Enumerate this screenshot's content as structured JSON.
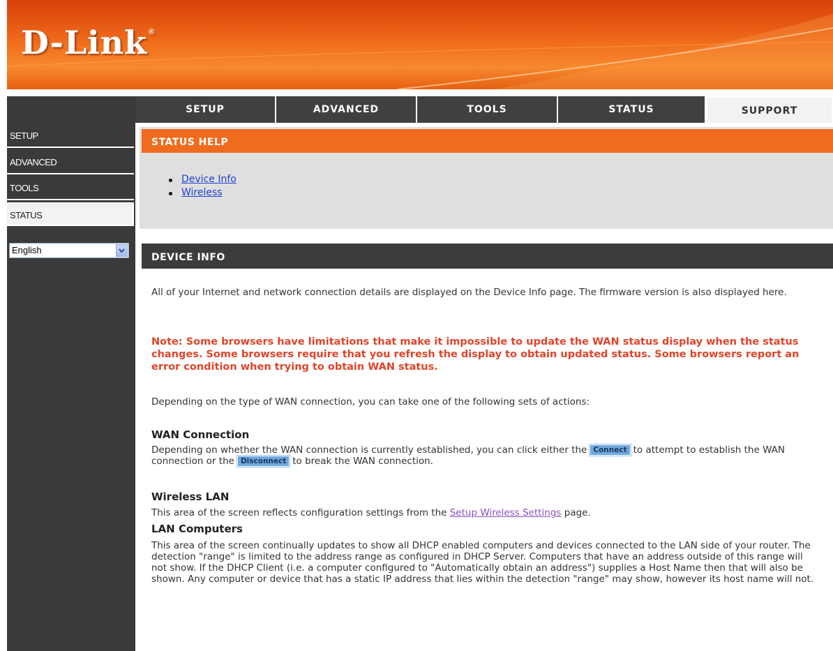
{
  "brand": {
    "logo_text": "D-Link",
    "logo_mark": "®"
  },
  "nav": {
    "tabs": [
      {
        "label": "SETUP",
        "active": false
      },
      {
        "label": "ADVANCED",
        "active": false
      },
      {
        "label": "TOOLS",
        "active": false
      },
      {
        "label": "STATUS",
        "active": false
      },
      {
        "label": "SUPPORT",
        "active": true
      }
    ]
  },
  "sidebar": {
    "items": [
      {
        "label": "SETUP",
        "active": false
      },
      {
        "label": "ADVANCED",
        "active": false
      },
      {
        "label": "TOOLS",
        "active": false
      },
      {
        "label": "STATUS",
        "active": true
      }
    ],
    "language": {
      "selected": "English"
    }
  },
  "status_help": {
    "title": "STATUS HELP",
    "links": [
      {
        "label": "Device Info"
      },
      {
        "label": "Wireless"
      }
    ]
  },
  "device_info": {
    "title": "DEVICE INFO",
    "intro": "All of your Internet and network connection details are displayed on the Device Info page. The firmware version is also displayed here.",
    "note": "Note: Some browsers have limitations that make it impossible to update the WAN status display when the status changes. Some browsers require that you refresh the display to obtain updated status. Some browsers report an error condition when trying to obtain WAN status.",
    "actions_intro": "Depending on the type of WAN connection, you can take one of the following sets of actions:",
    "wan": {
      "heading": "WAN Connection",
      "text_1": "Depending on whether the WAN connection is currently established, you can click either the",
      "connect_label": "Connect",
      "text_2": "to attempt to establish the WAN connection or the",
      "disconnect_label": "Disconnect",
      "text_3": "to break the WAN connection."
    },
    "wireless_lan": {
      "heading": "Wireless LAN",
      "text_before": "This area of the screen reflects configuration settings from the",
      "link_label": "Setup Wireless Settings",
      "text_after": "page."
    },
    "lan_computers": {
      "heading": "LAN Computers",
      "text": "This area of the screen continually updates to show all DHCP enabled computers and devices connected to the LAN side of your router. The detection \"range\" is limited to the address range as configured in DHCP Server. Computers that have an address outside of this range will not show. If the DHCP Client (i.e. a computer configured to \"Automatically obtain an address\") supplies a Host Name then that will also be shown. Any computer or device that has a static IP address that lies within the detection \"range\" may show, however its host name will not."
    }
  },
  "colors": {
    "header_orange": "#ef6a1a",
    "nav_dark": "#3a3a3a",
    "bar_orange": "#ef6c1f",
    "note_red": "#e0442a",
    "link_blue": "#1e3fd0",
    "button_blue": "#6fa8dc"
  },
  "icons": {
    "language_dropdown": "chevron-down-icon"
  }
}
